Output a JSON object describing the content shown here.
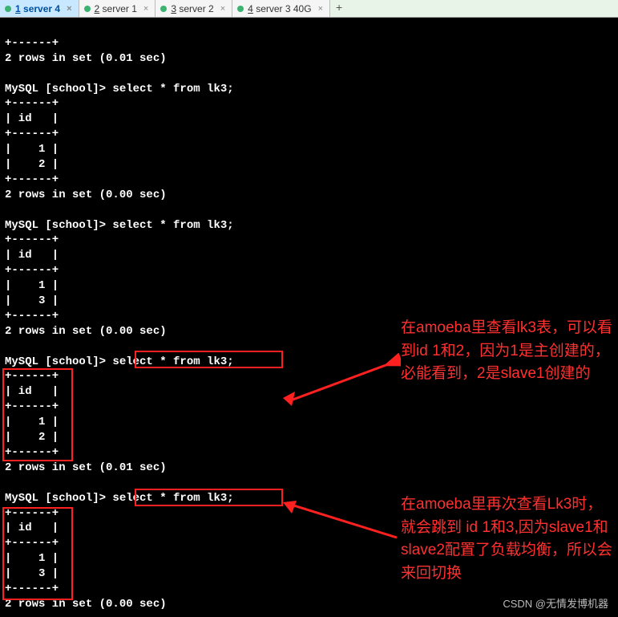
{
  "tabs": [
    {
      "num": "1",
      "label": "server 4",
      "active": true
    },
    {
      "num": "2",
      "label": "server 1",
      "active": false
    },
    {
      "num": "3",
      "label": "server 2",
      "active": false
    },
    {
      "num": "4",
      "label": "server 3 40G",
      "active": false
    }
  ],
  "terminal": {
    "line01": "+------+",
    "line02": "2 rows in set (0.01 sec)",
    "blank": "",
    "prompt": "MySQL [school]> ",
    "query": "select * from lk3;",
    "sep": "+------+",
    "hdr": "| id   |",
    "row1": "|    1 |",
    "row2": "|    2 |",
    "row3": "|    3 |",
    "res00": "2 rows in set (0.00 sec)",
    "res01": "2 rows in set (0.01 sec)"
  },
  "annotations": {
    "a1": "在amoeba里查看lk3表，可以看到id 1和2，因为1是主创建的，必能看到，2是slave1创建的",
    "a2": "在amoeba里再次查看Lk3时，就会跳到 id 1和3,因为slave1和slave2配置了负载均衡，所以会来回切换"
  },
  "watermark": "CSDN @无情发博机器"
}
